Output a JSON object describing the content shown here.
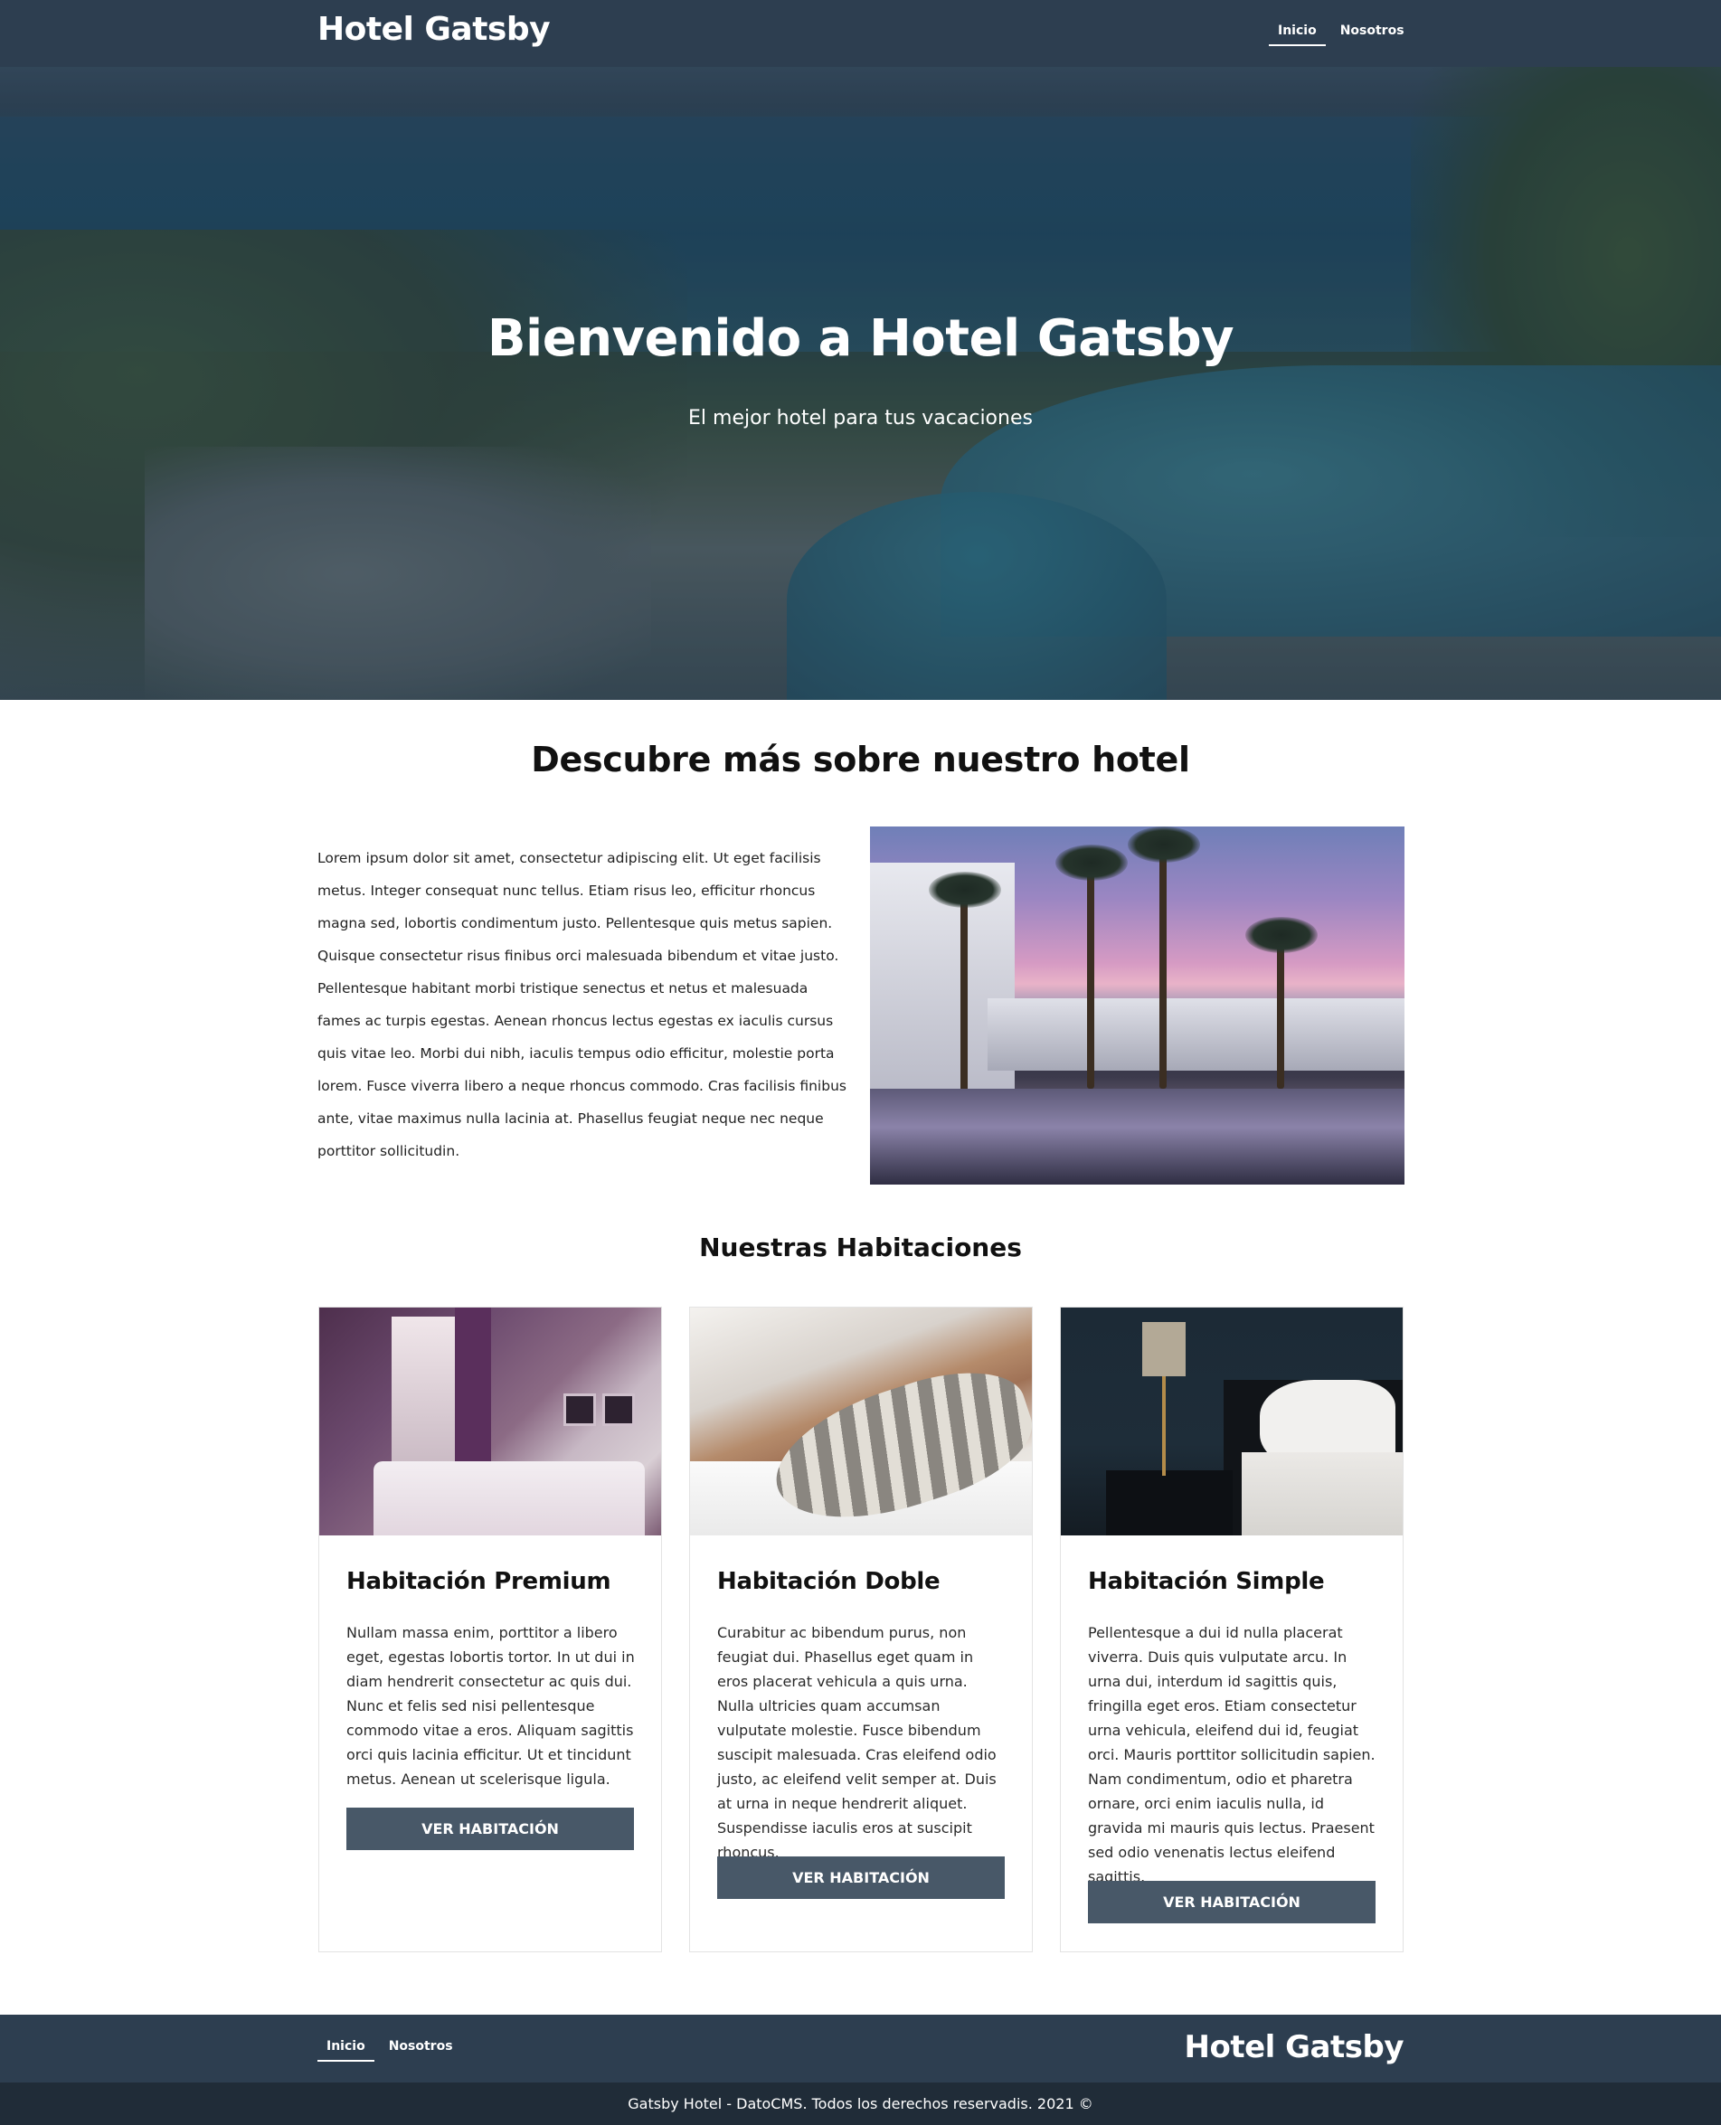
{
  "header": {
    "brand": "Hotel Gatsby",
    "nav": [
      {
        "label": "Inicio",
        "active": true
      },
      {
        "label": "Nosotros",
        "active": false
      }
    ]
  },
  "hero": {
    "title": "Bienvenido a Hotel Gatsby",
    "subtitle": "El mejor hotel para tus vacaciones"
  },
  "about": {
    "title": "Descubre más sobre nuestro hotel",
    "text": "Lorem ipsum dolor sit amet, consectetur adipiscing elit. Ut eget facilisis metus. Integer consequat nunc tellus. Etiam risus leo, efficitur rhoncus magna sed, lobortis condimentum justo. Pellentesque quis metus sapien. Quisque consectetur risus finibus orci malesuada bibendum et vitae justo. Pellentesque habitant morbi tristique senectus et netus et malesuada fames ac turpis egestas. Aenean rhoncus lectus egestas ex iaculis cursus quis vitae leo. Morbi dui nibh, iaculis tempus odio efficitur, molestie porta lorem. Fusce viverra libero a neque rhoncus commodo. Cras facilisis finibus ante, vitae maximus nulla lacinia at. Phasellus feugiat neque nec neque porttitor sollicitudin."
  },
  "rooms": {
    "title": "Nuestras Habitaciones",
    "items": [
      {
        "name": "Habitación Premium",
        "description": "Nullam massa enim, porttitor a libero eget, egestas lobortis tortor. In ut dui in diam hendrerit consectetur ac quis dui. Nunc et felis sed nisi pellentesque commodo vitae a eros. Aliquam sagittis orci quis lacinia efficitur. Ut et tincidunt metus. Aenean ut scelerisque ligula.",
        "button": "VER HABITACIÓN"
      },
      {
        "name": "Habitación Doble",
        "description": "Curabitur ac bibendum purus, non feugiat dui. Phasellus eget quam in eros placerat vehicula a quis urna. Nulla ultricies quam accumsan vulputate molestie. Fusce bibendum suscipit malesuada. Cras eleifend odio justo, ac eleifend velit semper at. Duis at urna in neque hendrerit aliquet. Suspendisse iaculis eros at suscipit rhoncus.",
        "button": "VER HABITACIÓN"
      },
      {
        "name": "Habitación Simple",
        "description": "Pellentesque a dui id nulla placerat viverra. Duis quis vulputate arcu. In urna dui, interdum id sagittis quis, fringilla eget eros. Etiam consectetur urna vehicula, eleifend dui id, feugiat orci. Mauris porttitor sollicitudin sapien. Nam condimentum, odio et pharetra ornare, orci enim iaculis nulla, id gravida mi mauris quis lectus. Praesent sed odio venenatis lectus eleifend sagittis.",
        "button": "VER HABITACIÓN"
      }
    ]
  },
  "footer": {
    "nav": [
      {
        "label": "Inicio",
        "active": true
      },
      {
        "label": "Nosotros",
        "active": false
      }
    ],
    "brand": "Hotel Gatsby",
    "copyright": "Gatsby Hotel - DatoCMS. Todos los derechos reservadis. 2021 ©"
  },
  "colors": {
    "header_bg": "#2d3e50",
    "copyright_bg": "#202c38",
    "button_bg": "#485868"
  }
}
